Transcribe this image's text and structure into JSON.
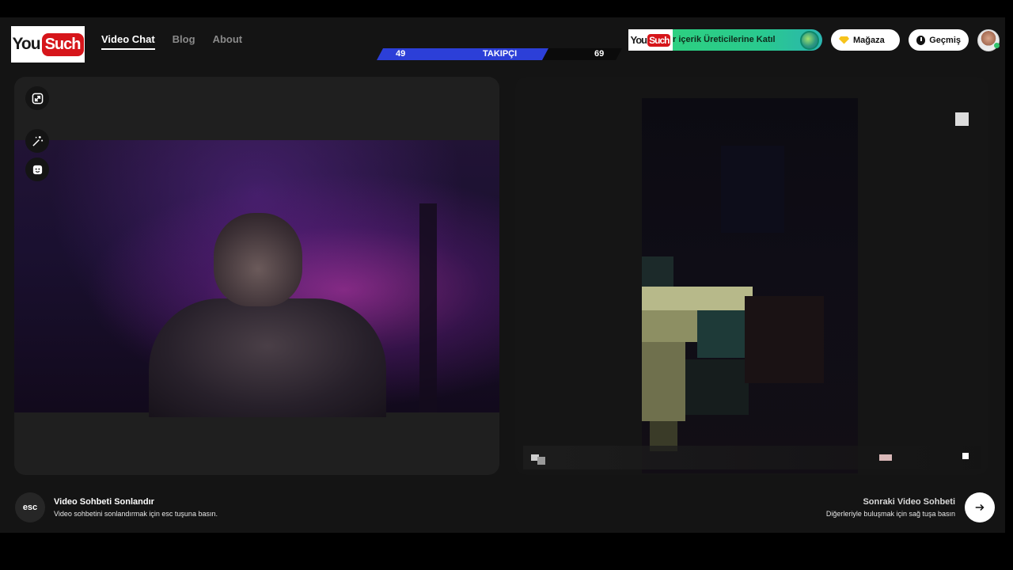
{
  "brand": {
    "logo_you": "You",
    "logo_such": "Such"
  },
  "nav": [
    {
      "label": "Video Chat",
      "active": true
    },
    {
      "label": "Blog",
      "active": false
    },
    {
      "label": "About",
      "active": false
    }
  ],
  "followers": {
    "left_value": "49",
    "label": "TAKIPÇI",
    "right_value": "69",
    "fill_fraction": 0.7
  },
  "banner": {
    "text": "r içerik Üreticilerine Katıl"
  },
  "header_buttons": {
    "store": "Mağaza",
    "history": "Geçmiş"
  },
  "footer": {
    "esc_key": "esc",
    "end_title": "Video Sohbeti Sonlandır",
    "end_subtitle": "Video sohbetini sonlandırmak için esc tuşuna basın.",
    "next_title": "Sonraki Video Sohbeti",
    "next_subtitle": "Diğerleriyle buluşmak için sağ tuşa basın"
  },
  "icons": {
    "expand": "expand-icon",
    "wand": "magic-wand-icon",
    "face": "face-filter-icon",
    "next": "arrow-right-icon",
    "store": "gem-icon",
    "history": "clock-icon"
  },
  "colors": {
    "background": "#141414",
    "follow_bar": "#2c3fd8",
    "banner_green": "#2fd37a",
    "logo_red": "#d6151a"
  }
}
